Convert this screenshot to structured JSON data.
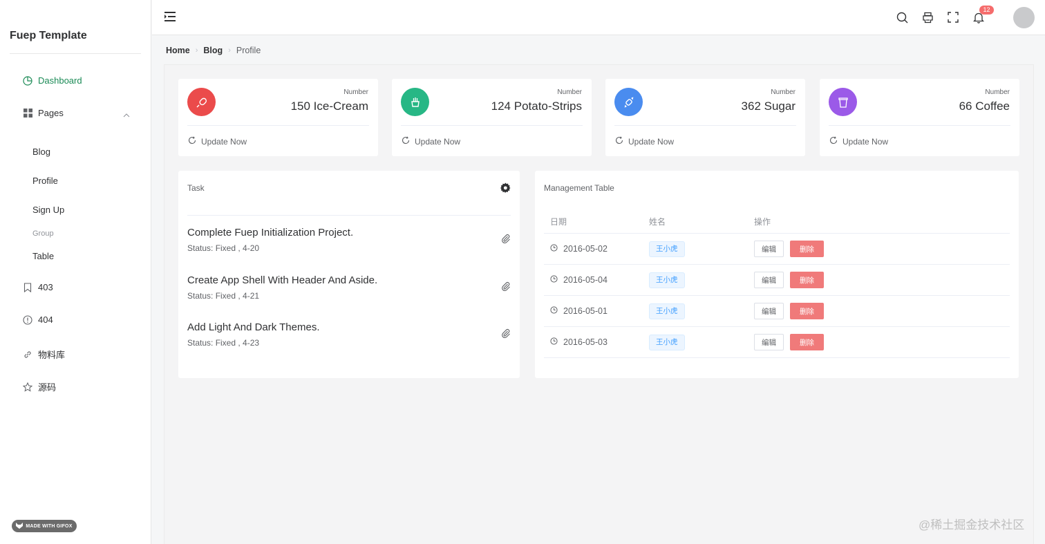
{
  "app": {
    "title": "Fuep Template"
  },
  "sidebar": {
    "dashboard": "Dashboard",
    "pages": "Pages",
    "sub_items": [
      "Blog",
      "Profile",
      "Sign Up"
    ],
    "group_label": "Group",
    "table": "Table",
    "item_403": "403",
    "item_404": "404",
    "materials": "物料库",
    "source": "源码",
    "active_color": "#1a8a55",
    "gifox_badge": "MADE WITH GIFOX"
  },
  "header": {
    "notification_count": "12"
  },
  "breadcrumb": [
    "Home",
    "Blog",
    "Profile"
  ],
  "stats": [
    {
      "label": "Number",
      "value": "150 Ice-Cream",
      "update": "Update Now",
      "color": "#eb4b4b",
      "icon": "ice-cream-icon"
    },
    {
      "label": "Number",
      "value": "124 Potato-Strips",
      "update": "Update Now",
      "color": "#27b785",
      "icon": "potato-strips-icon"
    },
    {
      "label": "Number",
      "value": "362 Sugar",
      "update": "Update Now",
      "color": "#4a8cef",
      "icon": "candy-icon"
    },
    {
      "label": "Number",
      "value": "66 Coffee",
      "update": "Update Now",
      "color": "#9b5ae8",
      "icon": "coffee-cup-icon"
    }
  ],
  "task_panel": {
    "title": "Task",
    "tasks": [
      {
        "title": "Complete Fuep Initialization Project.",
        "status": "Status: Fixed , 4-20"
      },
      {
        "title": "Create App Shell With Header And Aside.",
        "status": "Status: Fixed , 4-21"
      },
      {
        "title": "Add Light And Dark Themes.",
        "status": "Status: Fixed , 4-23"
      }
    ]
  },
  "table_panel": {
    "title": "Management Table",
    "columns": [
      "日期",
      "姓名",
      "操作"
    ],
    "rows": [
      {
        "date": "2016-05-02",
        "name": "王小虎",
        "edit": "编辑",
        "delete": "删除"
      },
      {
        "date": "2016-05-04",
        "name": "王小虎",
        "edit": "编辑",
        "delete": "删除"
      },
      {
        "date": "2016-05-01",
        "name": "王小虎",
        "edit": "编辑",
        "delete": "删除"
      },
      {
        "date": "2016-05-03",
        "name": "王小虎",
        "edit": "编辑",
        "delete": "删除"
      }
    ]
  },
  "watermark": "@稀土掘金技术社区"
}
